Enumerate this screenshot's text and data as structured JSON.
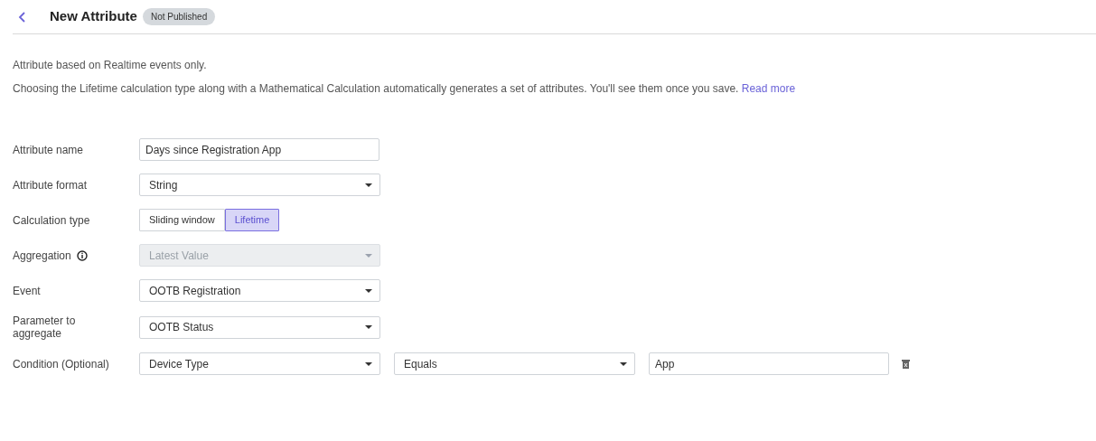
{
  "header": {
    "title": "New Attribute",
    "badge": "Not Published"
  },
  "notes": [
    {
      "text": "Attribute based on Realtime events only."
    },
    {
      "text": "Choosing the Lifetime calculation type along with a Mathematical Calculation automatically generates a set of attributes. You'll see them once you save.",
      "link": "Read more"
    }
  ],
  "fields": [
    {
      "kind": "text",
      "label": "Attribute name",
      "value": "Days since Registration App"
    },
    {
      "kind": "select",
      "label": "Attribute format",
      "value": "String",
      "disabled": false
    },
    {
      "kind": "toggle",
      "label": "Calculation type",
      "options": [
        {
          "label": "Sliding window",
          "selected": false
        },
        {
          "label": "Lifetime",
          "selected": true
        }
      ]
    },
    {
      "kind": "select",
      "label": "Aggregation",
      "info": true,
      "value": "Latest Value",
      "disabled": true
    },
    {
      "kind": "select",
      "label": "Event",
      "value": "OOTB Registration",
      "disabled": false
    },
    {
      "kind": "select",
      "label": "Parameter to aggregate",
      "value": "OOTB Status",
      "disabled": false
    },
    {
      "kind": "condition",
      "label": "Condition (Optional)",
      "property": "Device Type",
      "operator": "Equals",
      "value": "App"
    }
  ]
}
